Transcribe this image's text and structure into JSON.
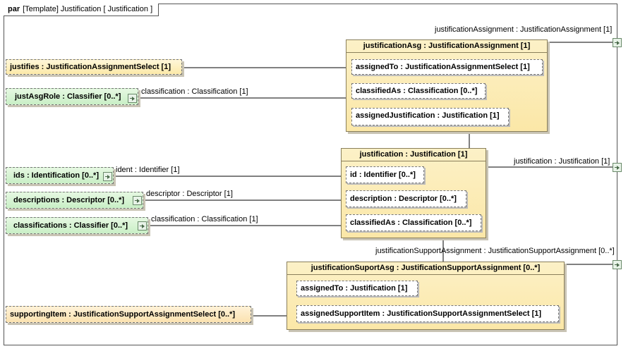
{
  "frame": {
    "keyword": "par",
    "label": "[Template] Justification [ Justification ]"
  },
  "boundary_ports": {
    "assignment_label": "justificationAssignment : JustificationAssignment [1]",
    "justification_label": "justification : Justification [1]",
    "support_label": "justificationSupportAssignment : JustificationSupportAssignment [0..*]"
  },
  "justification_asg": {
    "title": "justificationAsg : JustificationAssignment [1]",
    "assigned_to": "assignedTo : JustificationAssignmentSelect [1]",
    "classified_as": "classifiedAs : Classification [0..*]",
    "assigned_justification": "assignedJustification : Justification [1]"
  },
  "justification": {
    "title": "justification : Justification [1]",
    "id": "id : Identifier [0..*]",
    "description": "description : Descriptor [0..*]",
    "classified_as": "classifiedAs : Classification [0..*]"
  },
  "support_asg": {
    "title": "justificationSuportAsg : JustificationSupportAssignment [0..*]",
    "assigned_to": "assignedTo : Justification [1]",
    "assigned_support_item": "assignedSupportItem : JustificationSupportAssignmentSelect [1]"
  },
  "left_parts": {
    "justifies": "justifies : JustificationAssignmentSelect [1]",
    "just_asg_role": "justAsgRole : Classifier [0..*]",
    "ids": "ids : Identification [0..*]",
    "descriptions": "descriptions : Descriptor [0..*]",
    "classifications": "classifications : Classifier [0..*]",
    "supporting_item": "supportingItem : JustificationSupportAssignmentSelect [0..*]"
  },
  "connectors": {
    "classification_1": "classification : Classification [1]",
    "ident": "ident : Identifier [1]",
    "descriptor": "descriptor : Descriptor [1]",
    "classification_2": "classification : Classification [1]"
  }
}
